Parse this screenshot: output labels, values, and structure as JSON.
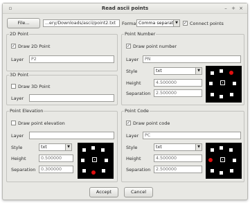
{
  "window": {
    "title": "Read ascii points"
  },
  "toolbar": {
    "file_button": "File...",
    "file_path": "...ery/Downloads/ascii/point2.txt",
    "format_label": "Format",
    "format_value": "Comma separator",
    "connect_label": "Connect points",
    "connect_checked": true
  },
  "point_2d": {
    "title": "2D Point",
    "draw_label": "Draw 2D Point",
    "draw_checked": true,
    "layer_label": "Layer",
    "layer_value": "P2"
  },
  "point_3d": {
    "title": "3D Point",
    "draw_label": "Draw 3D Point",
    "draw_checked": false,
    "layer_label": "Layer",
    "layer_value": ""
  },
  "point_number": {
    "title": "Point Number",
    "draw_label": "Draw point number",
    "draw_checked": true,
    "layer_label": "Layer",
    "layer_value": "PN",
    "style_label": "Style",
    "style_value": "txt",
    "height_label": "Height",
    "height_value": "4.500000",
    "separation_label": "Separation",
    "separation_value": "2.500000"
  },
  "point_elevation": {
    "title": "Point Elevation",
    "draw_label": "Draw point elevation",
    "draw_checked": false,
    "layer_label": "Layer",
    "layer_value": "",
    "style_label": "Style",
    "style_value": "txt",
    "height_label": "Height",
    "height_value": "0.500000",
    "separation_label": "Separation",
    "separation_value": "0.300000"
  },
  "point_code": {
    "title": "Point Code",
    "draw_label": "Draw point code",
    "draw_checked": true,
    "layer_label": "Layer",
    "layer_value": "PC",
    "style_label": "Style",
    "style_value": "txt",
    "height_label": "Height",
    "height_value": "4.500000",
    "separation_label": "Separation",
    "separation_value": "2.500000"
  },
  "buttons": {
    "accept": "Accept",
    "cancel": "Cancel"
  },
  "colors": {
    "preview_bg": "#000000",
    "marker": "#e01010"
  },
  "icons": {
    "minimize": "minimize-icon",
    "maximize": "maximize-icon",
    "close": "close-icon"
  }
}
